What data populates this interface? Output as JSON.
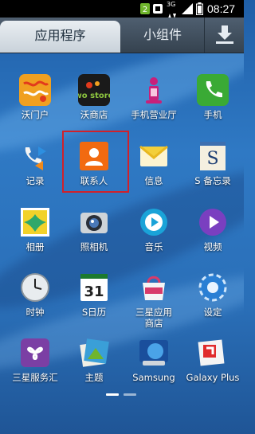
{
  "status_bar": {
    "time": "08:27",
    "network": "3G"
  },
  "tabs": {
    "apps": "应用程序",
    "widgets": "小组件"
  },
  "apps": [
    {
      "label": "沃门户",
      "icon": "unicom-portal-icon"
    },
    {
      "label": "沃商店",
      "icon": "wo-store-icon",
      "logo_text": "wo store"
    },
    {
      "label": "手机营业厅",
      "icon": "mobile-business-hall-icon"
    },
    {
      "label": "手机",
      "icon": "phone-icon"
    },
    {
      "label": "记录",
      "icon": "call-log-icon"
    },
    {
      "label": "联系人",
      "icon": "contacts-icon"
    },
    {
      "label": "信息",
      "icon": "messages-icon"
    },
    {
      "label": "S 备忘录",
      "icon": "s-memo-icon"
    },
    {
      "label": "相册",
      "icon": "gallery-icon"
    },
    {
      "label": "照相机",
      "icon": "camera-icon"
    },
    {
      "label": "音乐",
      "icon": "music-icon"
    },
    {
      "label": "视频",
      "icon": "video-icon"
    },
    {
      "label": "时钟",
      "icon": "clock-icon"
    },
    {
      "label": "S日历",
      "icon": "s-calendar-icon",
      "calendar_day": "31"
    },
    {
      "label": "三星应用商店",
      "icon": "samsung-apps-icon"
    },
    {
      "label": "设定",
      "icon": "settings-icon"
    },
    {
      "label": "三星服务汇",
      "icon": "samsung-service-icon"
    },
    {
      "label": "主题",
      "icon": "themes-icon"
    },
    {
      "label": "Samsung",
      "icon": "samsung-icon"
    },
    {
      "label": "Galaxy Plus",
      "icon": "galaxy-plus-icon"
    }
  ],
  "highlight_app": "联系人",
  "pager": {
    "pages": 2,
    "current": 1
  },
  "colors": {
    "highlight": "#d0212b",
    "tab_active": "#dfe6ec",
    "bg": "#2a6fb8"
  }
}
